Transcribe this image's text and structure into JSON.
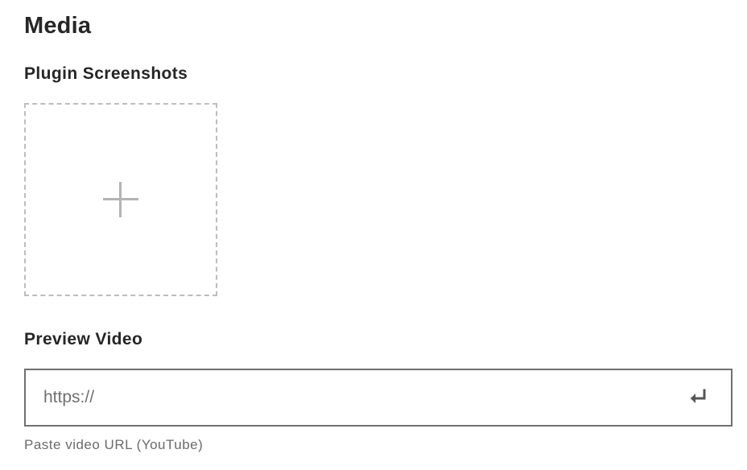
{
  "section": {
    "title": "Media"
  },
  "screenshots": {
    "label": "Plugin Screenshots",
    "add_icon": "plus-icon"
  },
  "video": {
    "label": "Preview Video",
    "input_value": "",
    "input_placeholder": "https://",
    "submit_icon": "enter-return-icon",
    "help_text": "Paste video URL (YouTube)"
  }
}
